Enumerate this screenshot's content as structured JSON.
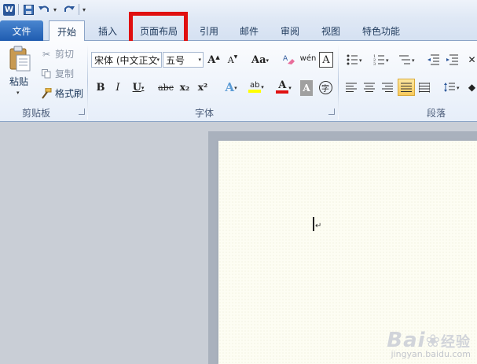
{
  "qat": {
    "logo": "W",
    "icons": [
      "save-icon",
      "undo-icon",
      "redo-icon",
      "customize-icon"
    ]
  },
  "tabs": {
    "file": "文件",
    "home": "开始",
    "insert": "插入",
    "page_layout": "页面布局",
    "references": "引用",
    "mailings": "邮件",
    "review": "审阅",
    "view": "视图",
    "special": "特色功能"
  },
  "clipboard": {
    "paste": "粘贴",
    "cut": "剪切",
    "copy": "复制",
    "format_painter": "格式刷",
    "group_label": "剪贴板"
  },
  "font": {
    "font_name": "宋体 (中文正文",
    "font_size": "五号",
    "grow": "A",
    "shrink": "A",
    "change_case": "Aa",
    "clear_format": "A",
    "bold": "B",
    "italic": "I",
    "underline": "U",
    "strike": "abc",
    "subscript": "x₂",
    "superscript": "x²",
    "text_effect": "A",
    "highlight": "ab",
    "font_color": "A",
    "char_shading": "A",
    "enclose": "字",
    "group_label": "字体"
  },
  "paragraph": {
    "group_label": "段落"
  },
  "colors": {
    "highlight_box": "#e01010",
    "file_tab": "#1f5cb0",
    "font_color_bar": "#e01010",
    "highlight_bar": "#ffff00"
  },
  "watermark": {
    "main": "Bai",
    "main2": "经验",
    "sub": "jingyan.baidu.com"
  }
}
